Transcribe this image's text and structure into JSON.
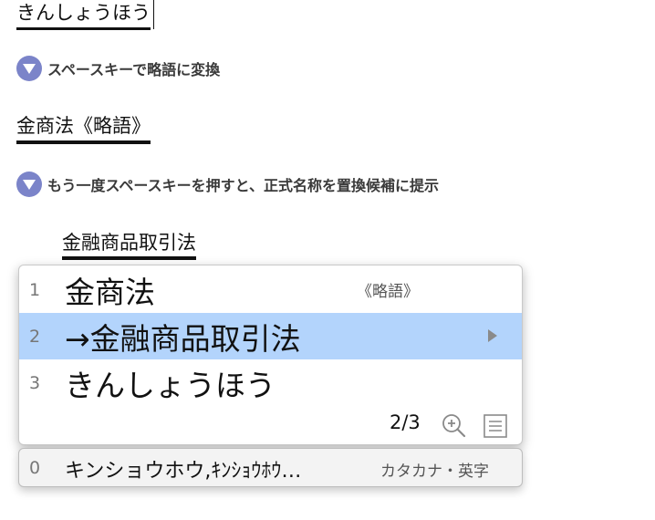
{
  "input": {
    "reading": "きんしょうほう"
  },
  "steps": {
    "step1": "スペースキーで略語に変換",
    "step2": "もう一度スペースキーを押すと、正式名称を置換候補に提示"
  },
  "converted": {
    "text": "金商法《略語》"
  },
  "reconverted": {
    "text": "金融商品取引法"
  },
  "candidates": {
    "items": [
      {
        "num": "1",
        "text": "金商法",
        "annotation": "《略語》"
      },
      {
        "num": "2",
        "text": "→金融商品取引法",
        "annotation": ""
      },
      {
        "num": "3",
        "text": "きんしょうほう",
        "annotation": ""
      }
    ],
    "page": "2/3",
    "selected_index": 2
  },
  "katakana": {
    "num": "0",
    "text": "キンショウホウ,ｷﾝｼｮｳﾎｳ…",
    "annotation": "カタカナ・英字"
  },
  "colors": {
    "step_icon": "#7b84c9",
    "selection": "#b3d4fc"
  }
}
